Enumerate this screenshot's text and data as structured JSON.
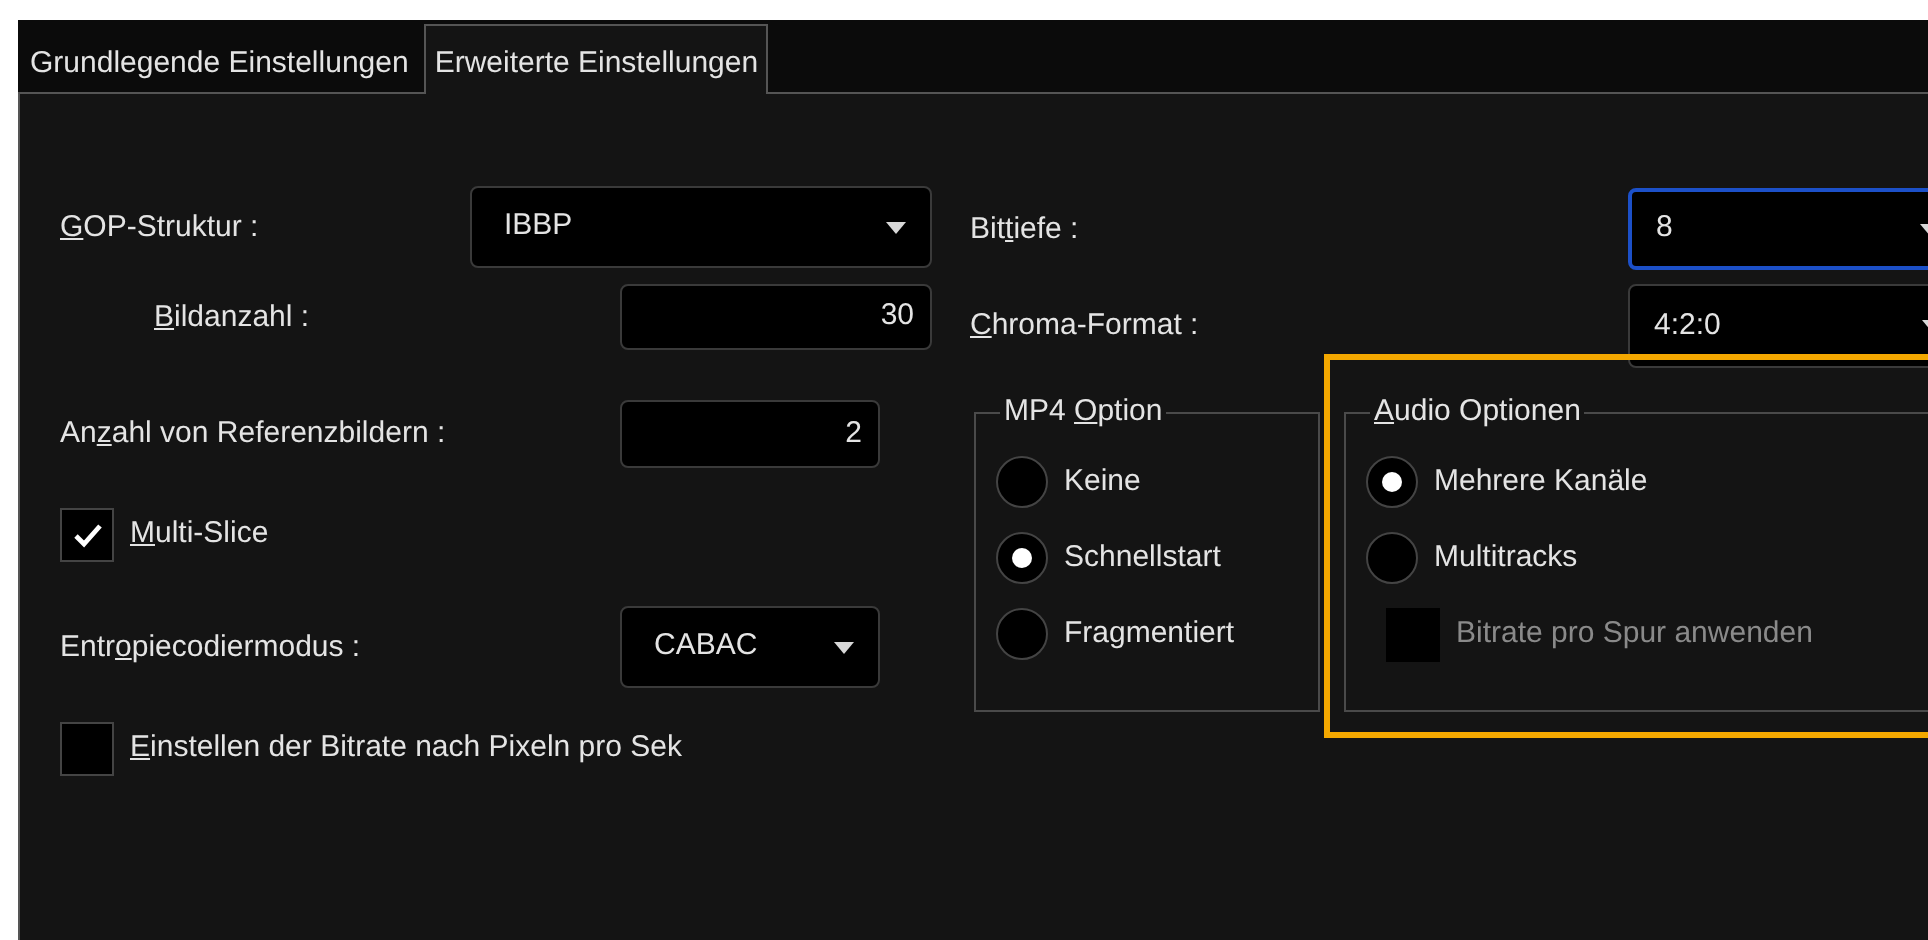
{
  "tabs": [
    {
      "label": "Grundlegende Einstellungen",
      "selected": false
    },
    {
      "label": "Erweiterte Einstellungen",
      "selected": true
    }
  ],
  "left_settings": [
    {
      "kind": "dropdown",
      "label": {
        "key": "G",
        "post": "OP-Struktur :"
      },
      "value": "IBBP",
      "children": [
        {
          "kind": "number",
          "label": {
            "key": "B",
            "post": "ildanzahl :"
          },
          "value": "30"
        }
      ]
    },
    {
      "kind": "number",
      "label": {
        "pre": "An",
        "key": "z",
        "post": "ahl von Referenzbildern :"
      },
      "value": "2"
    },
    {
      "kind": "checkbox",
      "label": {
        "key": "M",
        "post": "ulti-Slice"
      },
      "checked": true
    },
    {
      "kind": "dropdown",
      "label": {
        "pre": "Entr",
        "key": "o",
        "post": "piecodiermodus :"
      },
      "value": "CABAC"
    },
    {
      "kind": "checkbox",
      "label": {
        "key": "E",
        "post": "instellen der Bitrate nach Pixeln pro Sek"
      },
      "checked": false
    }
  ],
  "right_settings": [
    {
      "kind": "dropdown",
      "label": {
        "pre": "Bit",
        "key": "t",
        "post": "iefe :"
      },
      "value": "8",
      "focused": true
    },
    {
      "kind": "dropdown",
      "label": {
        "key": "C",
        "post": "hroma-Format :"
      },
      "value": "4:2:0",
      "focused": false
    }
  ],
  "mp4_option": {
    "title": {
      "pre": "MP4 ",
      "key": "O",
      "post": "ption"
    },
    "options": [
      {
        "label": "Keine",
        "selected": false
      },
      {
        "label": "Schnellstart",
        "selected": true
      },
      {
        "label": "Fragmentiert",
        "selected": false
      }
    ]
  },
  "audio_options": {
    "title": {
      "key": "A",
      "post": "udio Optionen"
    },
    "options": [
      {
        "label": "Mehrere Kanäle",
        "selected": true
      },
      {
        "label": "Multitracks",
        "selected": false
      }
    ],
    "checkbox": {
      "label": "Bitrate pro Spur anwenden",
      "checked": false,
      "disabled": true
    }
  }
}
